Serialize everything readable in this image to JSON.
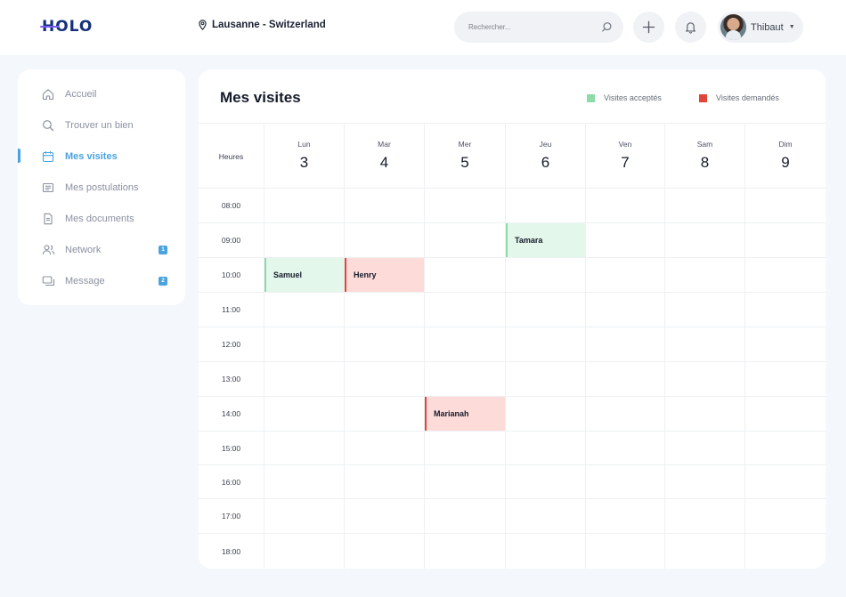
{
  "header": {
    "logo": "HOLO",
    "location": "Lausanne - Switzerland",
    "search_placeholder": "Rechercher...",
    "user_name": "Thibaut"
  },
  "sidebar": {
    "items": [
      {
        "label": "Accueil",
        "icon": "home-icon"
      },
      {
        "label": "Trouver un bien",
        "icon": "search-icon"
      },
      {
        "label": "Mes visites",
        "icon": "calendar-icon",
        "active": true
      },
      {
        "label": "Mes postulations",
        "icon": "list-icon"
      },
      {
        "label": "Mes documents",
        "icon": "document-icon"
      },
      {
        "label": "Network",
        "icon": "users-icon",
        "badge": "1"
      },
      {
        "label": "Message",
        "icon": "message-icon",
        "badge": "2"
      }
    ]
  },
  "calendar": {
    "title": "Mes visites",
    "legend": {
      "accepted": "Visites acceptés",
      "requested": "Visites demandés"
    },
    "colors": {
      "accepted": "#8fdaa9",
      "requested": "#e0443a",
      "accent": "#4aa3df"
    },
    "hours_label": "Heures",
    "days": [
      {
        "name": "Lun",
        "num": "3"
      },
      {
        "name": "Mar",
        "num": "4"
      },
      {
        "name": "Mer",
        "num": "5"
      },
      {
        "name": "Jeu",
        "num": "6"
      },
      {
        "name": "Ven",
        "num": "7"
      },
      {
        "name": "Sam",
        "num": "8"
      },
      {
        "name": "Dim",
        "num": "9"
      }
    ],
    "hours": [
      "08:00",
      "09:00",
      "10:00",
      "11:00",
      "12:00",
      "13:00",
      "14:00",
      "15:00",
      "16:00",
      "17:00",
      "18:00"
    ],
    "events": [
      {
        "name": "Tamara",
        "day": "Jeu",
        "time": "09:00",
        "status": "accepted"
      },
      {
        "name": "Samuel",
        "day": "Lun",
        "time": "10:00",
        "status": "accepted"
      },
      {
        "name": "Henry",
        "day": "Mar",
        "time": "10:00",
        "status": "requested"
      },
      {
        "name": "Marianah",
        "day": "Mer",
        "time": "14:00",
        "status": "requested"
      }
    ]
  }
}
